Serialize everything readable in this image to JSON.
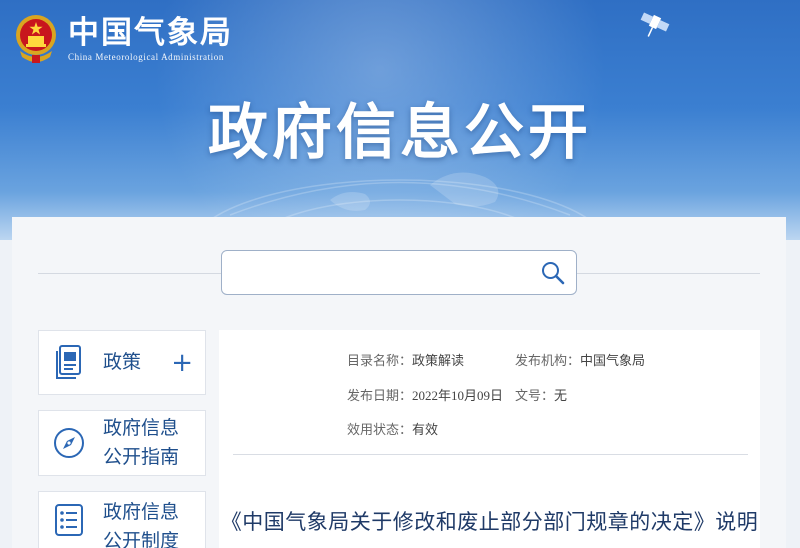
{
  "header": {
    "logo_cn": "中国气象局",
    "logo_en": "China Meteorological Administration",
    "title": "政府信息公开"
  },
  "search": {
    "value": "",
    "placeholder": "",
    "icon": "search-icon"
  },
  "sidebar": {
    "items": [
      {
        "label": "政策",
        "icon": "document-icon",
        "expand": "+"
      },
      {
        "label": "政府信息公开指南",
        "label_lines": [
          "政府信息",
          "公开指南"
        ],
        "icon": "compass-icon"
      },
      {
        "label": "政府信息公开制度",
        "label_lines": [
          "政府信息",
          "公开制度"
        ],
        "icon": "list-icon"
      }
    ]
  },
  "detail": {
    "catalog_label": "目录名称：",
    "catalog_value": "政策解读",
    "publisher_label": "发布机构：",
    "publisher_value": "中国气象局",
    "date_label": "发布日期：",
    "date_value": "2022年10月09日",
    "docno_label": "文号：",
    "docno_value": "无",
    "status_label": "效用状态：",
    "status_value": "有效",
    "title": "《中国气象局关于修改和废止部分部门规章的决定》说明"
  },
  "colors": {
    "banner_top": "#2f6fc4",
    "nav_text": "#1f4f8c",
    "accent": "#2b67b5",
    "title_text": "#1f3a67"
  }
}
